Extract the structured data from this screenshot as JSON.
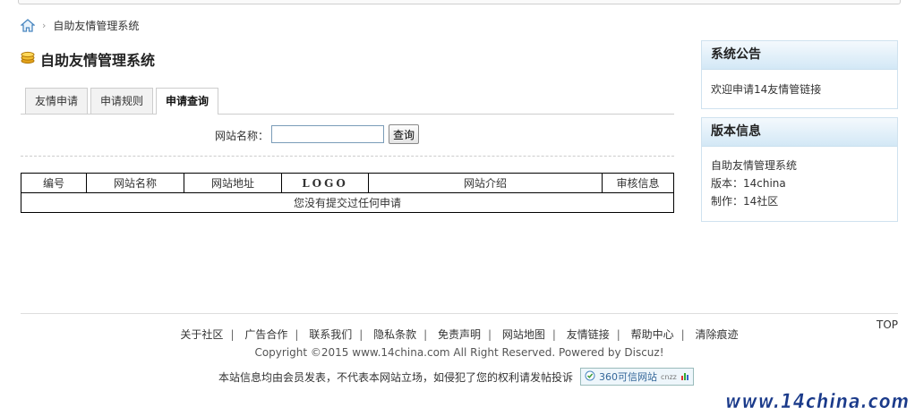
{
  "breadcrumb": {
    "current": "自助友情管理系统",
    "separator": "›"
  },
  "page_title": "自助友情管理系统",
  "tabs": [
    {
      "label": "友情申请",
      "active": false
    },
    {
      "label": "申请规则",
      "active": false
    },
    {
      "label": "申请查询",
      "active": true
    }
  ],
  "search": {
    "label": "网站名称：",
    "value": "",
    "button": "查询"
  },
  "table": {
    "headers": [
      "编号",
      "网站名称",
      "网站地址",
      "LOGO",
      "网站介绍",
      "审核信息"
    ],
    "empty_message": "您没有提交过任何申请"
  },
  "notice": {
    "title": "系统公告",
    "text": "欢迎申请14友情管链接"
  },
  "version": {
    "title": "版本信息",
    "lines": [
      "自助友情管理系统",
      "版本：14china",
      "制作：14社区"
    ]
  },
  "footer": {
    "links": [
      "关于社区",
      "广告合作",
      "联系我们",
      "隐私条款",
      "免责声明",
      "网站地图",
      "友情链接",
      "帮助中心",
      "清除痕迹"
    ],
    "copyright": "Copyright ©2015 www.14china.com All Right Reserved.  Powered by Discuz!",
    "disclaimer": "本站信息均由会员发表，不代表本网站立场，如侵犯了您的权利请发帖投诉",
    "badge": "360可信网站",
    "badge_small": "cnzz",
    "top": "TOP",
    "watermark": "www.14china.com"
  },
  "colors": {
    "box_header": "#d3e8f6",
    "box_border": "#cfe2ef",
    "watermark": "#1a3a8a"
  }
}
